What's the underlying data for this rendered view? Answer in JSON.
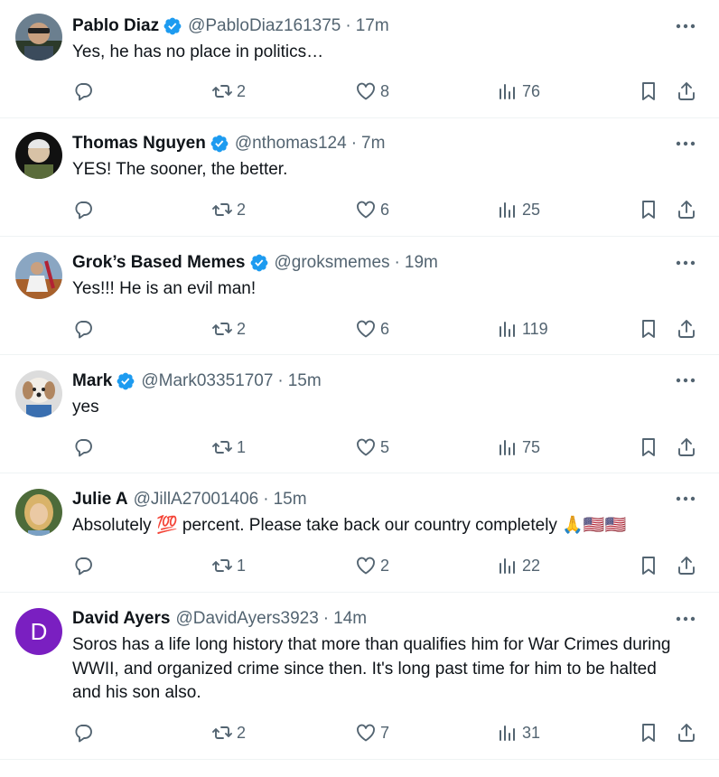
{
  "tweets": [
    {
      "name": "Pablo Diaz",
      "verified": true,
      "handle": "@PabloDiaz161375",
      "sep": "·",
      "time": "17m",
      "text": "Yes, he has no place in politics…",
      "replies": "",
      "reposts": "2",
      "likes": "8",
      "views": "76"
    },
    {
      "name": "Thomas Nguyen",
      "verified": true,
      "handle": "@nthomas124",
      "sep": "·",
      "time": "7m",
      "text": "YES! The sooner, the better.",
      "replies": "",
      "reposts": "2",
      "likes": "6",
      "views": "25"
    },
    {
      "name": "Grok’s Based Memes",
      "verified": true,
      "handle": "@groksmemes",
      "sep": "·",
      "time": "19m",
      "text": "Yes!!! He is an evil man!",
      "replies": "",
      "reposts": "2",
      "likes": "6",
      "views": "119"
    },
    {
      "name": "Mark",
      "verified": true,
      "handle": "@Mark03351707",
      "sep": "·",
      "time": "15m",
      "text": "yes",
      "replies": "",
      "reposts": "1",
      "likes": "5",
      "views": "75"
    },
    {
      "name": "Julie A",
      "verified": false,
      "handle": "@JillA27001406",
      "sep": "·",
      "time": "15m",
      "text": "Absolutely 💯 percent.  Please take back our country completely 🙏🇺🇸🇺🇸",
      "replies": "",
      "reposts": "1",
      "likes": "2",
      "views": "22"
    },
    {
      "name": "David Ayers",
      "verified": false,
      "handle": "@DavidAyers3923",
      "sep": "·",
      "time": "14m",
      "text": "Soros has a life long history that more than qualifies him for War Crimes during WWII, and organized crime since then. It's long past time for him to be halted and his son also.",
      "avatar_letter": "D",
      "replies": "",
      "reposts": "2",
      "likes": "7",
      "views": "31"
    }
  ],
  "colors": {
    "text": "#0f1419",
    "muted": "#536471",
    "verified": "#1d9bf0",
    "divider": "#eff3f4",
    "letter_avatar": "#7a1fc1"
  },
  "icons": [
    "reply-icon",
    "repost-icon",
    "like-icon",
    "views-icon",
    "bookmark-icon",
    "share-icon",
    "more-icon",
    "verified-badge-icon"
  ]
}
